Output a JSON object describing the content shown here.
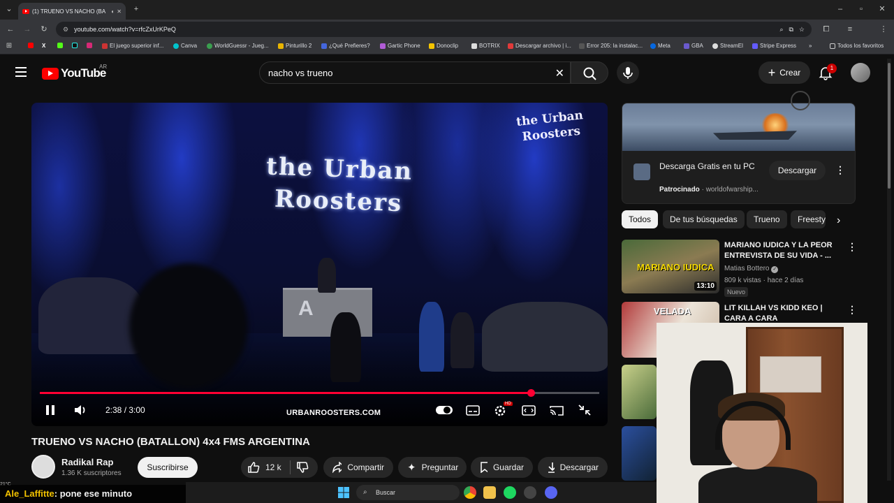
{
  "browser": {
    "tab_title": "(1) TRUENO VS NACHO (BA",
    "url": "youtube.com/watch?v=rfcZxUrKPeQ",
    "bookmarks": [
      "El juego superior inf...",
      "Canva",
      "WorldGuessr - Jueg...",
      "Pinturillo 2",
      "¿Qué Prefieres?",
      "Gartic Phone",
      "Donoclip",
      "BOTRIX",
      "Descargar archivo | i...",
      "Error 205: la instalac...",
      "Meta",
      "GBA",
      "StreamEl",
      "Stripe Express"
    ],
    "all_favorites": "Todos los favoritos"
  },
  "header": {
    "logo_text": "YouTube",
    "region": "AR",
    "search_value": "nacho vs trueno",
    "create_label": "Crear",
    "notification_count": "1"
  },
  "player": {
    "stage_logo": "the Urban Roosters",
    "corner_logo": "the Urban Roosters",
    "booth_label": "A",
    "watermark": "URBANROOSTERS.COM",
    "time": "2:38 / 3:00",
    "progress": 0.878,
    "hd_badge": "HD"
  },
  "video": {
    "title": "TRUENO VS NACHO (BATALLON) 4x4 FMS ARGENTINA",
    "channel_name": "Radikal Rap",
    "subscribers": "1.36 K suscriptores",
    "subscribe_label": "Suscribirse",
    "likes": "12 k",
    "share_label": "Compartir",
    "ask_label": "Preguntar",
    "save_label": "Guardar",
    "download_label": "Descargar"
  },
  "ad": {
    "title": "Descarga Gratis en tu PC",
    "sponsored": "Patrocinado",
    "advertiser": "worldofwarship...",
    "button": "Descargar"
  },
  "chips": [
    "Todos",
    "De tus búsquedas",
    "Trueno",
    "Freesty"
  ],
  "recommendations": [
    {
      "title": "MARIANO IUDICA Y LA PEOR ENTREVISTA DE SU VIDA - ...",
      "channel": "Matias Bottero",
      "meta": "809 k vistas · hace 2 días",
      "duration": "13:10",
      "badge": "Nuevo",
      "thumb_text": "MARIANO IUDICA"
    },
    {
      "title": "LIT KILLAH VS KIDD KEO | CARA A CARA",
      "thumb_text": "VELADA"
    }
  ],
  "stream": {
    "chat_user": "Ale_Laffitte",
    "chat_message": ": pone ese minuto",
    "weather": "21°C"
  },
  "taskbar": {
    "search_label": "Buscar"
  },
  "colors": {
    "accent_red": "#ff0033",
    "youtube_red": "#ff0000",
    "background": "#0f0f0f"
  }
}
